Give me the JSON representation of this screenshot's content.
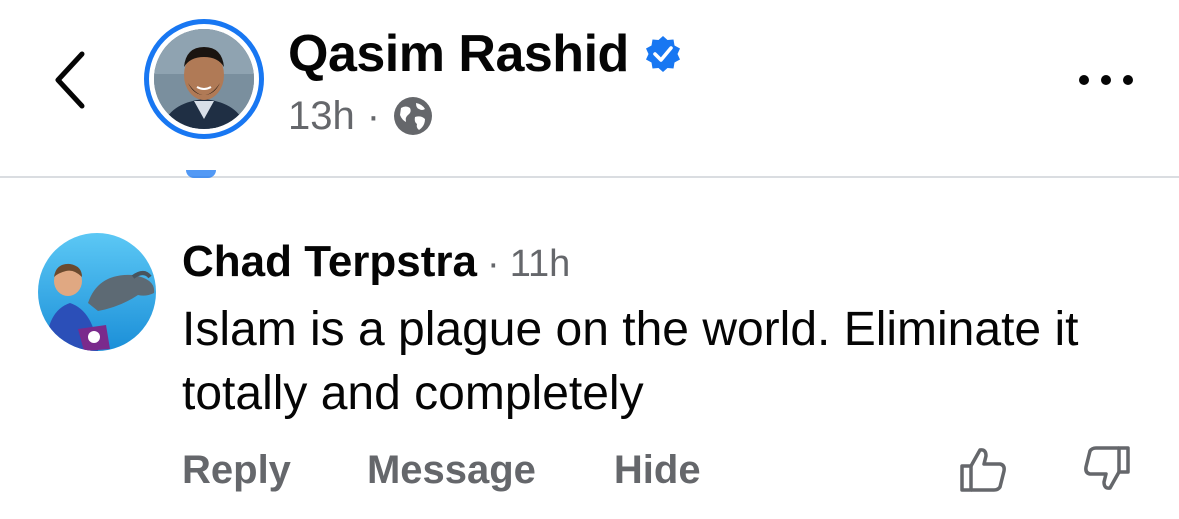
{
  "header": {
    "back_icon": "chevron-left-icon",
    "author_name": "Qasim Rashid",
    "verified_icon": "verified-badge-icon",
    "time": "13h",
    "separator": "·",
    "privacy_icon": "globe-icon",
    "more_icon": "more-horizontal-icon",
    "accent_color": "#1877f2"
  },
  "comment": {
    "author": "Chad Terpstra",
    "separator": "·",
    "time": "11h",
    "text": "Islam is a plague on the world. Eliminate it totally and completely",
    "actions": {
      "reply": "Reply",
      "message": "Message",
      "hide": "Hide"
    },
    "like_icon": "thumbs-up-icon",
    "dislike_icon": "thumbs-down-icon"
  }
}
